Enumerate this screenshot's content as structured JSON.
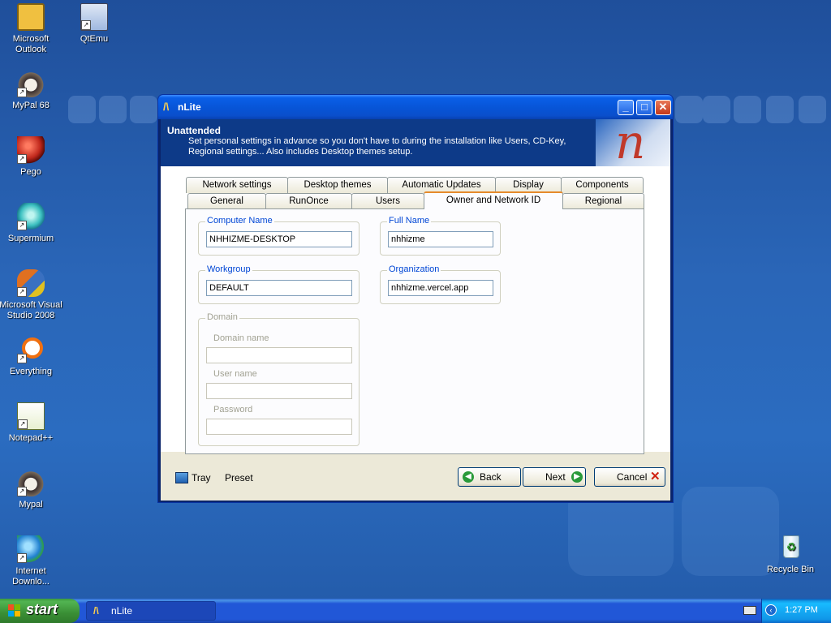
{
  "desktop": {
    "icons": [
      {
        "label": "Microsoft Outlook",
        "icon": "outlook-icon",
        "color": "#e8b020"
      },
      {
        "label": "QtEmu",
        "icon": "monitor-icon",
        "color": "#6aa0e0"
      },
      {
        "label": "MyPal 68",
        "icon": "raccoon-icon",
        "color": "#8a6a4a"
      },
      {
        "label": "Pego",
        "icon": "red-ball-icon",
        "color": "#c0281c"
      },
      {
        "label": "Supermium",
        "icon": "supermium-icon",
        "color": "#3cc0c0"
      },
      {
        "label": "Microsoft Visual Studio 2008",
        "icon": "visual-studio-icon",
        "color": "#e07020"
      },
      {
        "label": "Everything",
        "icon": "magnifier-icon",
        "color": "#e06010"
      },
      {
        "label": "Notepad++",
        "icon": "notepad-icon",
        "color": "#80c040"
      },
      {
        "label": "Mypal",
        "icon": "raccoon-icon",
        "color": "#8a6a4a"
      },
      {
        "label": "Internet Downlo...",
        "icon": "globe-download-icon",
        "color": "#30a040"
      },
      {
        "label": "Recycle Bin",
        "icon": "recycle-bin-icon",
        "color": "#50b050"
      }
    ]
  },
  "window": {
    "title": "nLite",
    "header": {
      "title": "Unattended",
      "description": "Set personal settings in advance so you don't have to during the installation like Users, CD-Key, Regional settings... Also includes Desktop themes setup."
    },
    "tabs_row1": [
      "Network settings",
      "Desktop themes",
      "Automatic Updates",
      "Display",
      "Components"
    ],
    "tabs_row2": [
      "General",
      "RunOnce",
      "Users",
      "Owner and Network ID",
      "Regional"
    ],
    "active_tab": "Owner and Network ID",
    "fields": {
      "computer_name_label": "Computer Name",
      "computer_name_value": "NHHIZME-DESKTOP",
      "full_name_label": "Full Name",
      "full_name_value": "nhhizme",
      "workgroup_label": "Workgroup",
      "workgroup_value": "DEFAULT",
      "organization_label": "Organization",
      "organization_value": "nhhizme.vercel.app",
      "domain_label": "Domain",
      "domain_name_label": "Domain name",
      "domain_name_value": "",
      "user_name_label": "User name",
      "user_name_value": "",
      "password_label": "Password",
      "password_value": ""
    },
    "footer": {
      "tray_label": "Tray",
      "preset_label": "Preset",
      "back_label": "Back",
      "next_label": "Next",
      "cancel_label": "Cancel"
    }
  },
  "taskbar": {
    "start_label": "start",
    "task_label": "nLite",
    "clock": "1:27 PM"
  }
}
